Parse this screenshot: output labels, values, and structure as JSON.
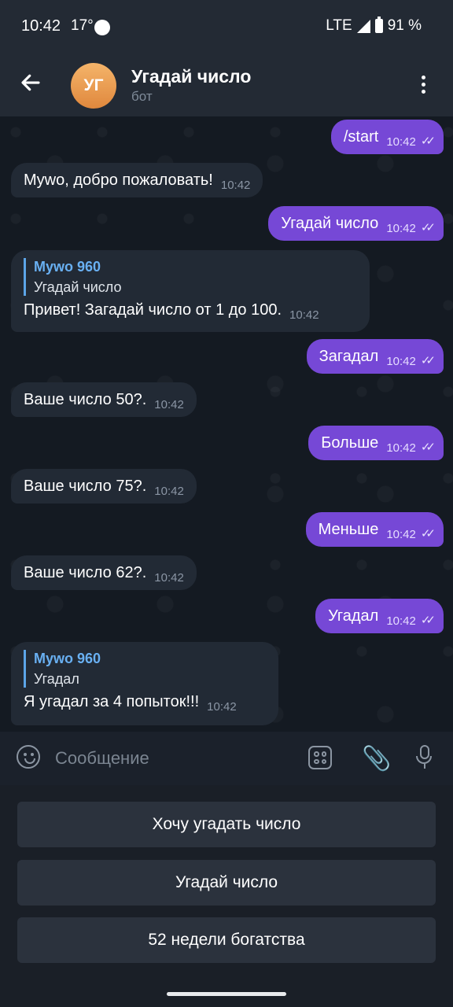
{
  "status_bar": {
    "time": "10:42",
    "temperature": "17°",
    "network": "LTE",
    "battery": "91 %"
  },
  "header": {
    "avatar_initials": "УГ",
    "title": "Угадай число",
    "subtitle": "бот"
  },
  "messages": [
    {
      "direction": "out",
      "text": "/start",
      "time": "10:42"
    },
    {
      "direction": "in",
      "text": "Мywo, добро пожаловать!",
      "time": "10:42"
    },
    {
      "direction": "out",
      "text": "Угадай число",
      "time": "10:42"
    },
    {
      "direction": "in",
      "quote_name": "Мywo 960",
      "quote_text": "Угадай число",
      "text": "Привет! Загадай число от 1 до 100.",
      "time": "10:42"
    },
    {
      "direction": "out",
      "text": "Загадал",
      "time": "10:42"
    },
    {
      "direction": "in",
      "text": "Ваше число 50?.",
      "time": "10:42"
    },
    {
      "direction": "out",
      "text": "Больше",
      "time": "10:42"
    },
    {
      "direction": "in",
      "text": "Ваше число 75?.",
      "time": "10:42"
    },
    {
      "direction": "out",
      "text": "Меньше",
      "time": "10:42"
    },
    {
      "direction": "in",
      "text": "Ваше число 62?.",
      "time": "10:42"
    },
    {
      "direction": "out",
      "text": "Угадал",
      "time": "10:42"
    },
    {
      "direction": "in",
      "quote_name": "Мywo 960",
      "quote_text": "Угадал",
      "text": "Я угадал за 4 попыток!!!",
      "time": "10:42"
    }
  ],
  "composer": {
    "placeholder": "Сообщение"
  },
  "keyboard_buttons": [
    "Хочу угадать число",
    "Угадай число",
    "52 недели богатства"
  ],
  "colors": {
    "outgoing": "#7648d6",
    "incoming": "#222a35",
    "header": "#232a34"
  }
}
